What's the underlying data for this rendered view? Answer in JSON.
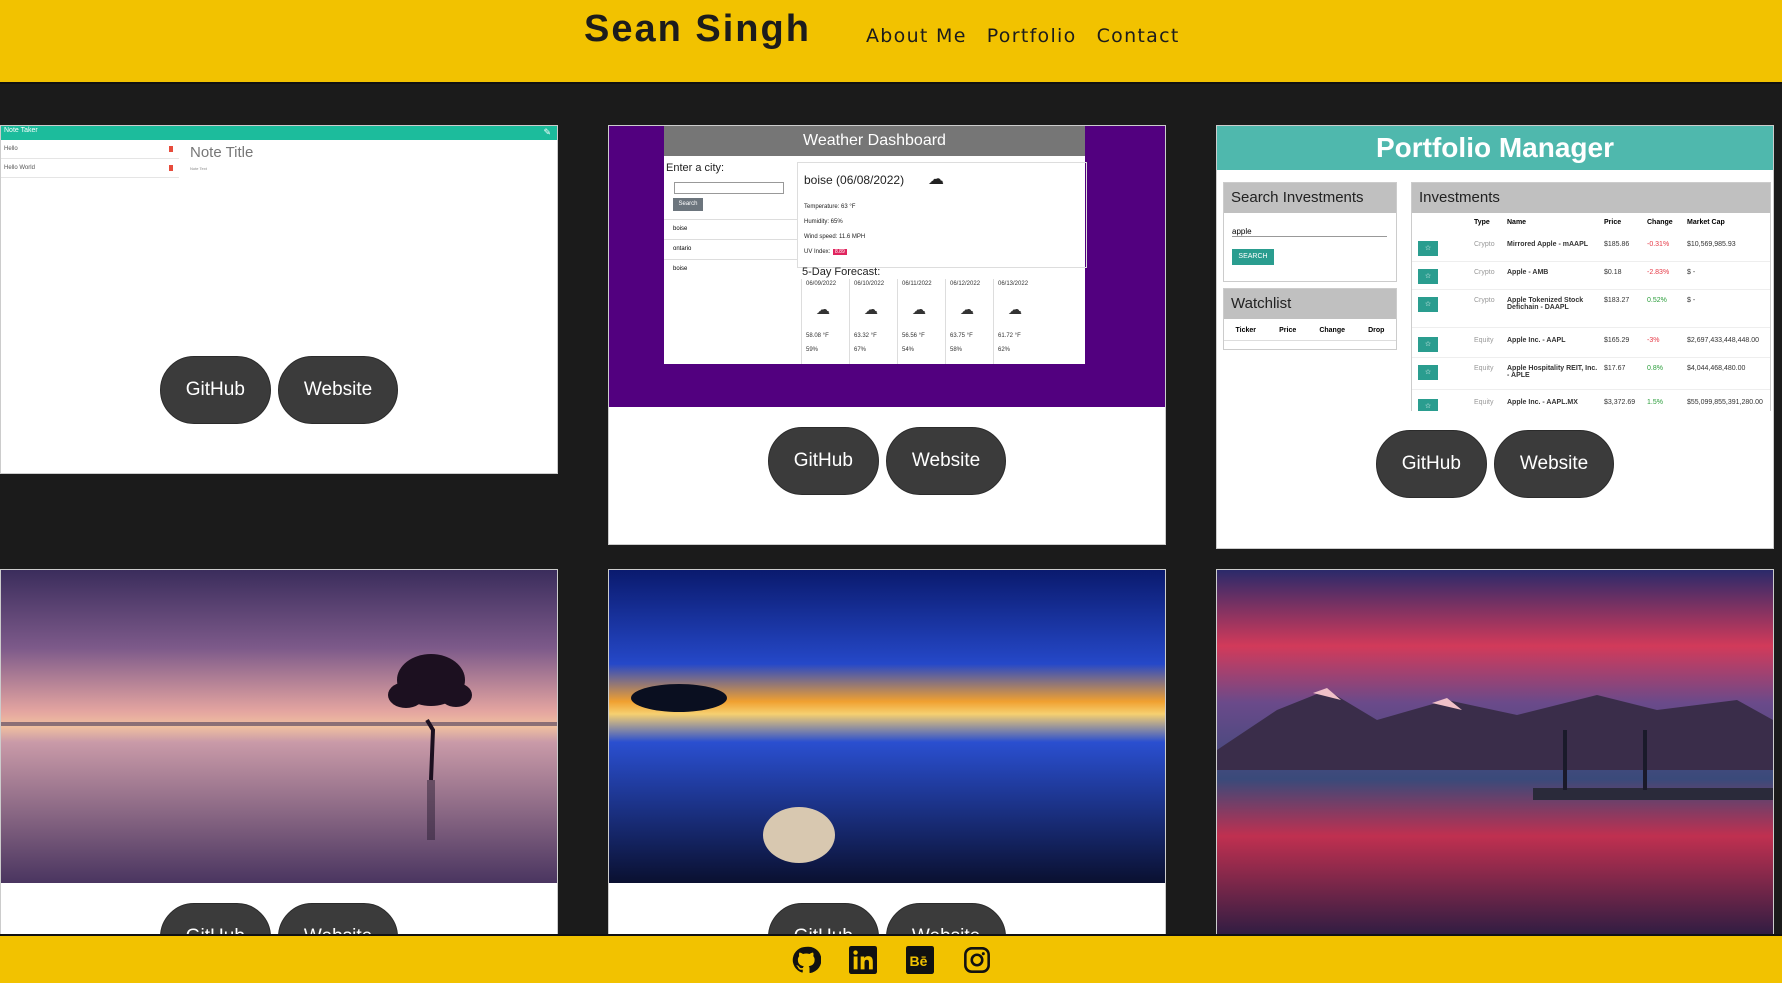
{
  "header": {
    "brand": "Sean Singh",
    "nav": [
      "About Me",
      "Portfolio",
      "Contact"
    ]
  },
  "buttons": {
    "github": "GitHub",
    "website": "Website"
  },
  "projects": {
    "note_taker": {
      "app_title": "Note Taker",
      "notes": [
        "Hello",
        "Hello World"
      ],
      "note_title": "Note Title",
      "note_text": "Note Text"
    },
    "weather": {
      "title": "Weather Dashboard",
      "enter_city": "Enter a city:",
      "search": "Search",
      "history": [
        "boise",
        "ontario",
        "boise"
      ],
      "current": "boise (06/08/2022)",
      "temperature": "Temperature: 63 °F",
      "humidity": "Humidity: 65%",
      "wind": "Wind speed: 11.6 MPH",
      "uv_label": "UV Index:",
      "uv_value": "8.89",
      "forecast_title": "5-Day Forecast:",
      "forecast": [
        {
          "date": "06/09/2022",
          "temp": "58.08 °F",
          "hum": "59%"
        },
        {
          "date": "06/10/2022",
          "temp": "63.32 °F",
          "hum": "67%"
        },
        {
          "date": "06/11/2022",
          "temp": "56.56 °F",
          "hum": "54%"
        },
        {
          "date": "06/12/2022",
          "temp": "63.75 °F",
          "hum": "58%"
        },
        {
          "date": "06/13/2022",
          "temp": "61.72 °F",
          "hum": "62%"
        }
      ]
    },
    "portfolio_manager": {
      "title": "Portfolio Manager",
      "search_header": "Search Investments",
      "search_value": "apple",
      "search_button": "SEARCH",
      "watchlist_header": "Watchlist",
      "watchlist_cols": [
        "Ticker",
        "Price",
        "Change",
        "Drop"
      ],
      "investments_header": "Investments",
      "inv_cols": [
        "Type",
        "Name",
        "Price",
        "Change",
        "Market Cap"
      ],
      "rows": [
        {
          "type": "Crypto",
          "name": "Mirrored Apple - mAAPL",
          "price": "$185.86",
          "change": "-0.31%",
          "cap": "$10,569,985.93"
        },
        {
          "type": "Crypto",
          "name": "Apple - AMB",
          "price": "$0.18",
          "change": "-2.83%",
          "cap": "$ -"
        },
        {
          "type": "Crypto",
          "name": "Apple Tokenized Stock Defichain - DAAPL",
          "price": "$183.27",
          "change": "0.52%",
          "cap": "$ -"
        },
        {
          "type": "Equity",
          "name": "Apple Inc. - AAPL",
          "price": "$165.29",
          "change": "-3%",
          "cap": "$2,697,433,448,448.00"
        },
        {
          "type": "Equity",
          "name": "Apple Hospitality REIT, Inc. - APLE",
          "price": "$17.67",
          "change": "0.8%",
          "cap": "$4,044,468,480.00"
        },
        {
          "type": "Equity",
          "name": "Apple Inc. - AAPL.MX",
          "price": "$3,372.69",
          "change": "1.5%",
          "cap": "$55,099,855,391,280.00"
        }
      ]
    }
  },
  "footer": {
    "icons": [
      "github-icon",
      "linkedin-icon",
      "behance-icon",
      "instagram-icon"
    ]
  }
}
